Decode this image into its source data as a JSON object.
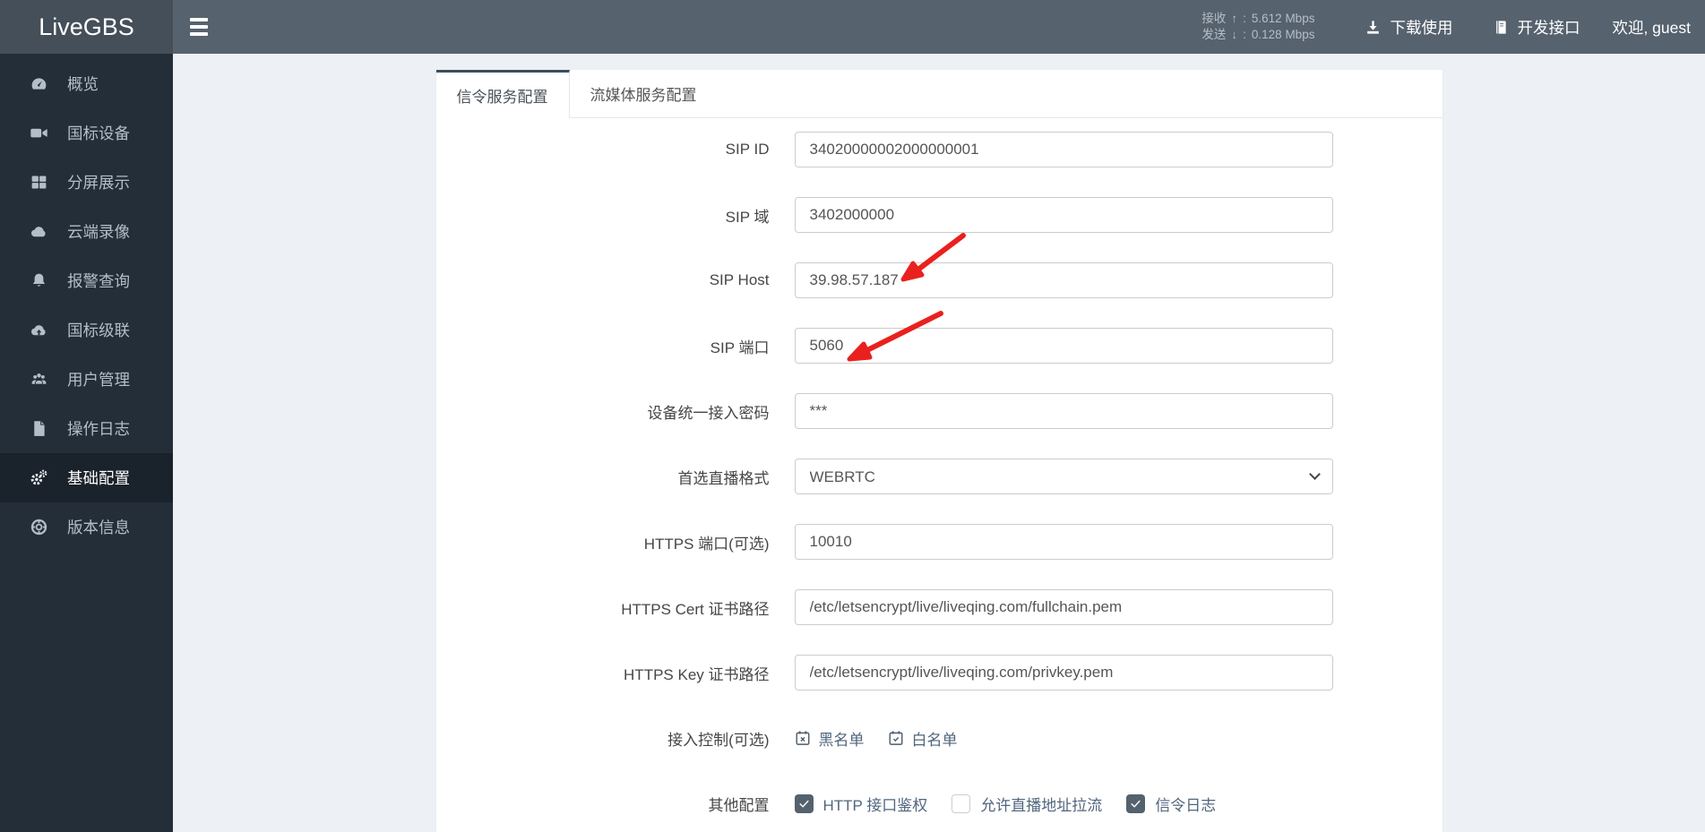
{
  "brand": "LiveGBS",
  "navbar": {
    "stats": {
      "rx_label": "接收",
      "rx_arrow": "↑",
      "rx_sep": ":",
      "rx_value": "5.612 Mbps",
      "tx_label": "发送",
      "tx_arrow": "↓",
      "tx_sep": ":",
      "tx_value": "0.128 Mbps"
    },
    "links": {
      "download": "下载使用",
      "api": "开发接口"
    },
    "welcome": "欢迎, guest"
  },
  "sidebar": {
    "items": [
      {
        "label": "概览",
        "icon": "dashboard-icon"
      },
      {
        "label": "国标设备",
        "icon": "camera-icon"
      },
      {
        "label": "分屏展示",
        "icon": "grid-icon"
      },
      {
        "label": "云端录像",
        "icon": "cloud-icon"
      },
      {
        "label": "报警查询",
        "icon": "bell-icon"
      },
      {
        "label": "国标级联",
        "icon": "cloud-upload-icon"
      },
      {
        "label": "用户管理",
        "icon": "users-icon"
      },
      {
        "label": "操作日志",
        "icon": "file-icon"
      },
      {
        "label": "基础配置",
        "icon": "gears-icon"
      },
      {
        "label": "版本信息",
        "icon": "info-icon"
      }
    ],
    "active_label": "基础配置"
  },
  "tabs": [
    {
      "label": "信令服务配置",
      "active": true
    },
    {
      "label": "流媒体服务配置",
      "active": false
    }
  ],
  "form": {
    "rows": [
      {
        "label": "SIP ID",
        "value": "34020000002000000001"
      },
      {
        "label": "SIP 域",
        "value": "3402000000"
      },
      {
        "label": "SIP Host",
        "value": "39.98.57.187"
      },
      {
        "label": "SIP 端口",
        "value": "5060"
      },
      {
        "label": "设备统一接入密码",
        "value": "***"
      },
      {
        "label": "首选直播格式",
        "value": "WEBRTC"
      },
      {
        "label": "HTTPS 端口(可选)",
        "value": "10010"
      },
      {
        "label": "HTTPS Cert 证书路径",
        "value": "/etc/letsencrypt/live/liveqing.com/fullchain.pem"
      },
      {
        "label": "HTTPS Key 证书路径",
        "value": "/etc/letsencrypt/live/liveqing.com/privkey.pem"
      }
    ],
    "access_control": {
      "label": "接入控制(可选)",
      "blacklist": "黑名单",
      "whitelist": "白名单"
    },
    "other": {
      "label": "其他配置",
      "options": [
        {
          "label": "HTTP 接口鉴权",
          "checked": true
        },
        {
          "label": "允许直播地址拉流",
          "checked": false
        },
        {
          "label": "信令日志",
          "checked": true
        }
      ]
    }
  },
  "annotations": [
    {
      "type": "red-arrow",
      "target": "SIP Host 输入值 39.98.57.187"
    },
    {
      "type": "red-arrow",
      "target": "SIP 端口 输入值 5060"
    }
  ],
  "colors": {
    "navbar_bg": "#56626e",
    "brand_bg": "#454f59",
    "sidebar_bg": "#242e38",
    "sidebar_active_bg": "#1a222b",
    "page_bg": "#edf0f4",
    "tab_accent": "#3e4d5c",
    "checkbox_checked": "#54626e",
    "link_slate": "#4f657c",
    "arrow_red": "#e9211e"
  }
}
